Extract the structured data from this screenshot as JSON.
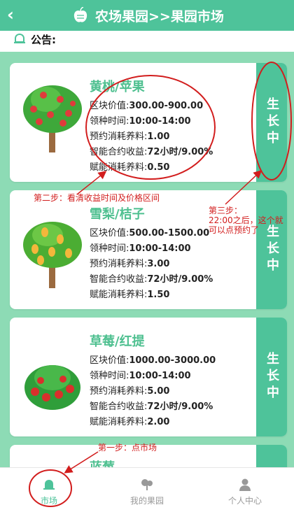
{
  "header": {
    "title": "农场果园>>果园市场",
    "back_icon": "chevron-left-icon",
    "logo_icon": "fruit-logo-icon"
  },
  "notice": {
    "label": "公告:",
    "icon": "bell-icon"
  },
  "cards": [
    {
      "name": "黄桃/苹果",
      "block_value_label": "区块价值:",
      "block_value": "300.00-900.00",
      "time_label": "领种时间:",
      "time": "10:00-14:00",
      "reserve_label": "预约消耗养料:",
      "reserve": "1.00",
      "yield_label": "智能合约收益:",
      "yield": "72小时/9.00%",
      "energy_label": "赋能消耗养料:",
      "energy": "0.50",
      "status": "生长中"
    },
    {
      "name": "雪梨/桔子",
      "block_value_label": "区块价值:",
      "block_value": "500.00-1500.00",
      "time_label": "领种时间:",
      "time": "10:00-14:00",
      "reserve_label": "预约消耗养料:",
      "reserve": "3.00",
      "yield_label": "智能合约收益:",
      "yield": "72小时/9.00%",
      "energy_label": "赋能消耗养料:",
      "energy": "1.50",
      "status": "生长中"
    },
    {
      "name": "草莓/红提",
      "block_value_label": "区块价值:",
      "block_value": "1000.00-3000.00",
      "time_label": "领种时间:",
      "time": "10:00-14:00",
      "reserve_label": "预约消耗养料:",
      "reserve": "5.00",
      "yield_label": "智能合约收益:",
      "yield": "72小时/9.00%",
      "energy_label": "赋能消耗养料:",
      "energy": "2.00",
      "status": "生长中"
    },
    {
      "name": "蓝莓"
    }
  ],
  "tabs": [
    {
      "label": "市场",
      "icon": "bell-icon",
      "active": true
    },
    {
      "label": "我的果园",
      "icon": "tree-icon",
      "active": false
    },
    {
      "label": "个人中心",
      "icon": "user-icon",
      "active": false
    }
  ],
  "annotations": {
    "step1": "第一步：点市场",
    "step2": "第二步：看清收益时间及价格区间",
    "step3_line1": "第三步：",
    "step3_line2": "22:00之后，这个就",
    "step3_line3": "可以点预约了"
  },
  "colors": {
    "accent": "#4ec39a",
    "background": "#8ddbb5",
    "annotation": "#d21d1d"
  }
}
